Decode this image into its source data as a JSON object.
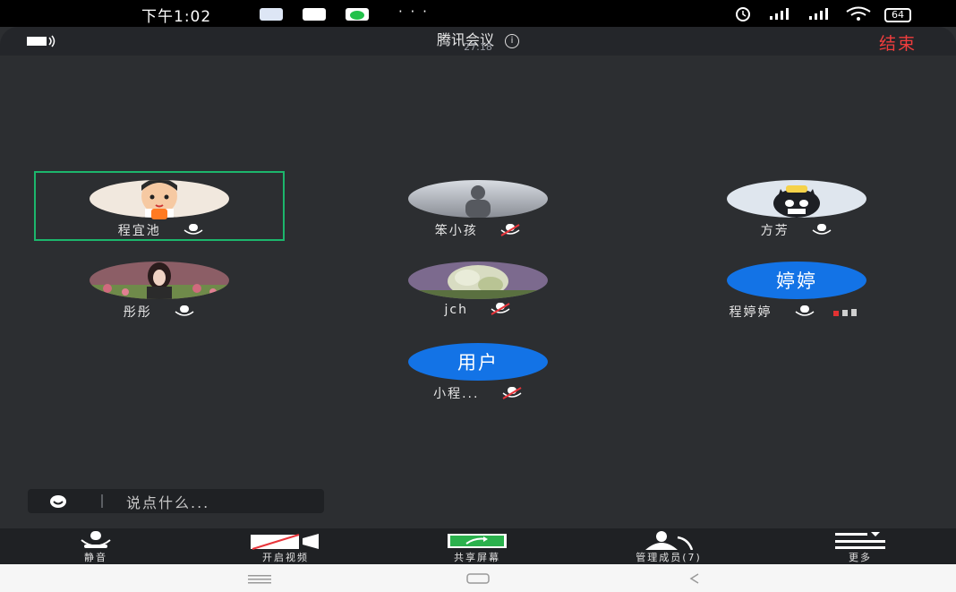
{
  "status_bar": {
    "time": "下午1:02",
    "more": "· · ·",
    "battery": "64"
  },
  "header": {
    "title": "腾讯会议",
    "timer": "27:18",
    "end_label": "结束"
  },
  "participants": [
    {
      "name": "程宜池",
      "avatar_type": "photo",
      "host": true,
      "active_speaker": true,
      "mic": "on"
    },
    {
      "name": "笨小孩",
      "avatar_type": "photo",
      "mic": "muted"
    },
    {
      "name": "方芳",
      "avatar_type": "photo",
      "mic": "on"
    },
    {
      "name": "彤彤",
      "avatar_type": "photo",
      "mic": "on"
    },
    {
      "name": "jch",
      "avatar_type": "photo",
      "mic": "muted"
    },
    {
      "name": "程婷婷",
      "avatar_type": "text",
      "avatar_text": "婷婷",
      "mic": "on"
    },
    {
      "name": "小程...",
      "avatar_type": "text",
      "avatar_text": "用户",
      "mic": "muted"
    }
  ],
  "chat": {
    "placeholder": "说点什么..."
  },
  "toolbar": {
    "mute": "静音",
    "video": "开启视频",
    "share": "共享屏幕",
    "members": "管理成员(7)",
    "more": "更多"
  },
  "colors": {
    "accent_blue": "#1373e6",
    "end_red": "#f03d3d",
    "active_green": "#1cb66c",
    "host_orange": "#ff7a22"
  }
}
